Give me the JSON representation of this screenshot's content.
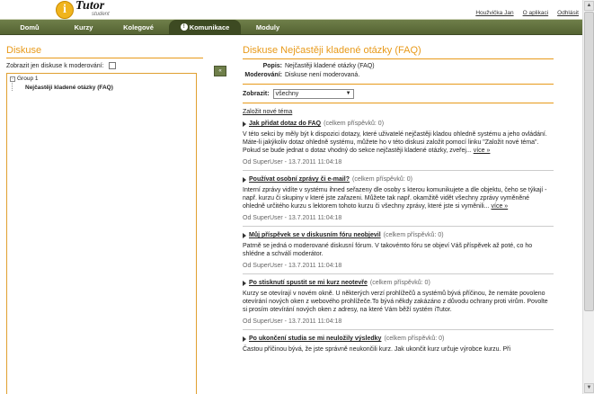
{
  "logo": {
    "letter": "i",
    "name": "Tutor",
    "sub": "student"
  },
  "toplinks": [
    "Houžvička Jan",
    "O aplikaci",
    "Odhlásit"
  ],
  "nav": [
    {
      "label": "Domů",
      "active": false
    },
    {
      "label": "Kurzy",
      "active": false
    },
    {
      "label": "Kolegové",
      "active": false
    },
    {
      "label": "Komunikace",
      "active": true
    },
    {
      "label": "Moduly",
      "active": false
    }
  ],
  "left": {
    "title": "Diskuse",
    "moderated_label": "Zobrazit jen diskuse k moderování:",
    "tree": [
      {
        "label": "Group 1",
        "box": "-"
      },
      {
        "label": "Nejčastěji kladené otázky (FAQ)",
        "bold": true
      }
    ],
    "collapse_glyph": "«"
  },
  "right": {
    "title": "Diskuse Nejčastěji kladené otázky (FAQ)",
    "popis_label": "Popis:",
    "popis_value": "Nejčastěji kladené otázky (FAQ)",
    "moder_label": "Moderování:",
    "moder_value": "Diskuse není moderovaná.",
    "filter_label": "Zobrazit:",
    "filter_value": "všechny",
    "new_topic": "Založit nové téma",
    "topics": [
      {
        "title": "Jak přidat dotaz do FAQ",
        "count": "(celkem příspěvků: 0)",
        "body": "V této sekci by měly být k dispozici dotazy, které uživatelé nejčastěji kladou ohledně systému a jeho ovládání. Máte-li jakýkoliv dotaz ohledně systému, můžete ho v této diskusi založit pomocí linku \"Založit nové téma\". Pokud se bude jednat o dotaz vhodný do sekce nejčastěji kladené otázky, zveřej...",
        "more": "více »",
        "by": "Od SuperUser - 13.7.2011 11:04:18"
      },
      {
        "title": "Používat osobní zprávy či e-mail?",
        "count": "(celkem příspěvků: 0)",
        "body": "Interní zprávy vidíte v systému ihned seřazeny dle osoby s kterou komunikujete a dle objektu, čeho se týkají - např. kurzu či skupiny v které jste zařazeni. Můžete tak např. okamžitě vidět všechny zprávy vyměněné ohledně určitého kurzu s lektorem tohoto kurzu či všechny zprávy, které jste si vyměnili...",
        "more": "více »",
        "by": "Od SuperUser - 13.7.2011 11:04:18"
      },
      {
        "title": "Můj příspěvek se v diskusním fóru neobjevil",
        "count": "(celkem příspěvků: 0)",
        "body": "Patrně se jedná o moderované diskusní fórum. V takovémto fóru se objeví Váš příspěvek až poté, co ho shlédne a schválí moderátor.",
        "more": "",
        "by": "Od SuperUser - 13.7.2011 11:04:18"
      },
      {
        "title": "Po stisknutí spustit se mi kurz neotevře",
        "count": "(celkem příspěvků: 0)",
        "body": "Kurzy se otevírají v novém okně. U některých verzí prohlížečů a systémů bývá příčinou, že nemáte povoleno otevírání nových oken z webového prohlížeče.To bývá někdy zakázáno z důvodu ochrany proti virům. Povolte si prosím otevírání nových oken z adresy, na které Vám běží systém iTutor.",
        "more": "",
        "by": "Od SuperUser - 13.7.2011 11:04:18"
      },
      {
        "title": "Po ukončení studia se mi neuložily výsledky",
        "count": "(celkem příspěvků: 0)",
        "body": "Častou příčinou bývá, že jste správně neukončili kurz. Jak ukončit kurz určuje výrobce kurzu. Při",
        "more": "",
        "by": ""
      }
    ]
  }
}
